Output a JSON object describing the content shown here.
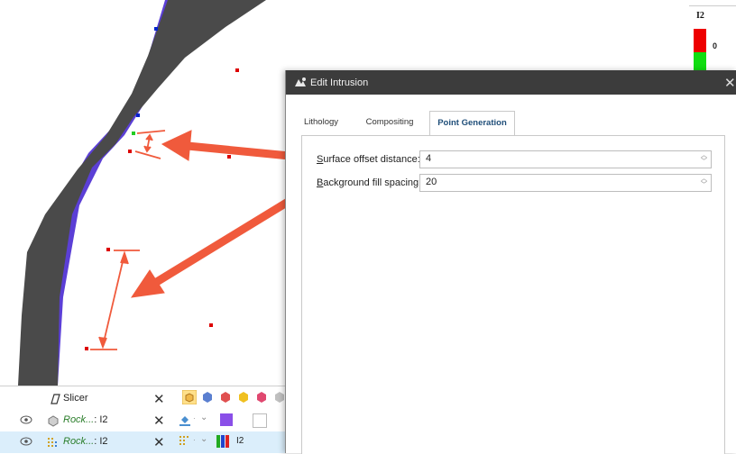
{
  "legend": {
    "title": "I2",
    "value_label": "0"
  },
  "scene_list": {
    "rows": [
      {
        "name": "Slicer",
        "italic_prefix": "",
        "suffix": "",
        "close": "✕"
      },
      {
        "name": "",
        "italic_prefix": "Rock...",
        "suffix": ": I2",
        "close": "✕"
      },
      {
        "name": "",
        "italic_prefix": "Rock...",
        "suffix": ": I2",
        "close": "✕",
        "colormap_label": "I2"
      }
    ]
  },
  "dialog": {
    "title": "Edit Intrusion",
    "close": "✕",
    "tabs": [
      {
        "label": "Lithology",
        "active": false
      },
      {
        "label": "Compositing",
        "active": false
      },
      {
        "label": "Point Generation",
        "active": true
      }
    ],
    "fields": {
      "surface_offset": {
        "mnemonic": "S",
        "label_rest": "urface offset distance:",
        "value": "4"
      },
      "background_fill": {
        "mnemonic": "B",
        "label_rest": "ackground fill spacing:",
        "value": "20"
      }
    }
  },
  "colors": {
    "accent": "#1f5ea8",
    "arrow": "#f05a3c",
    "surface": "#4a4a4a",
    "edge": "#5b3fd6",
    "legend_red": "#ee0000",
    "legend_green": "#11dd11"
  }
}
